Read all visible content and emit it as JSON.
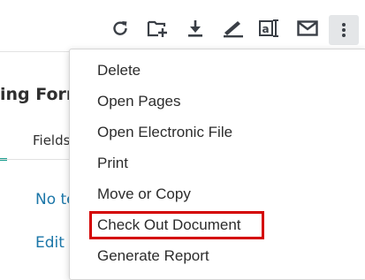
{
  "toolbar": {
    "buttons": [
      {
        "name": "refresh-icon"
      },
      {
        "name": "add-folder-icon"
      },
      {
        "name": "download-icon"
      },
      {
        "name": "sign-icon"
      },
      {
        "name": "text-recognition-icon"
      },
      {
        "name": "mail-icon"
      },
      {
        "name": "more-vertical-icon"
      }
    ]
  },
  "background": {
    "title_fragment": "ing Form",
    "tab_fragment": "Fields",
    "link_1_fragment": "No te",
    "link_2_fragment": "Edit"
  },
  "menu": {
    "items": [
      {
        "label": "Delete"
      },
      {
        "label": "Open Pages"
      },
      {
        "label": "Open Electronic File"
      },
      {
        "label": "Print"
      },
      {
        "label": "Move or Copy"
      },
      {
        "label": "Check Out Document",
        "highlighted": true
      },
      {
        "label": "Generate Report"
      }
    ]
  },
  "colors": {
    "highlight_border": "#d40000",
    "link": "#1b76a8",
    "accent": "#1a9e8f"
  }
}
